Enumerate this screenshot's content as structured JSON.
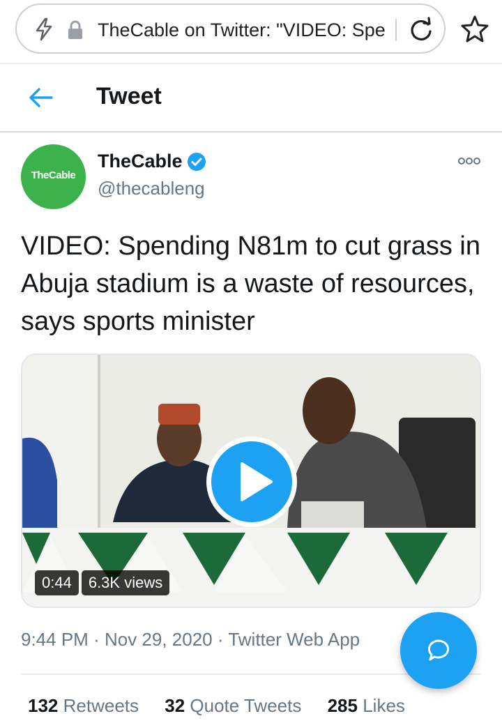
{
  "browser": {
    "url_title": "TheCable on Twitter: \"VIDEO: Spe",
    "icons": [
      "bolt-icon",
      "lock-icon",
      "reload-icon",
      "star-icon"
    ]
  },
  "header": {
    "title": "Tweet"
  },
  "author": {
    "avatar_text": "TheCable",
    "name": "TheCable",
    "handle": "@thecableng",
    "verified": true
  },
  "tweet": {
    "text": "VIDEO: Spending N81m to cut grass in Abuja stadium is a waste of resources, says sports minister"
  },
  "media": {
    "duration": "0:44",
    "views": "6.3K views"
  },
  "meta": {
    "time": "9:44 PM",
    "separator": "·",
    "date": "Nov 29, 2020",
    "source": "Twitter Web App"
  },
  "stats": {
    "retweets_count": "132",
    "retweets_label": "Retweets",
    "quotes_count": "32",
    "quotes_label": "Quote Tweets",
    "likes_count": "285",
    "likes_label": "Likes"
  },
  "colors": {
    "accent": "#1da1f2",
    "avatar_bg": "#3cb34a",
    "secondary_text": "#657786"
  }
}
